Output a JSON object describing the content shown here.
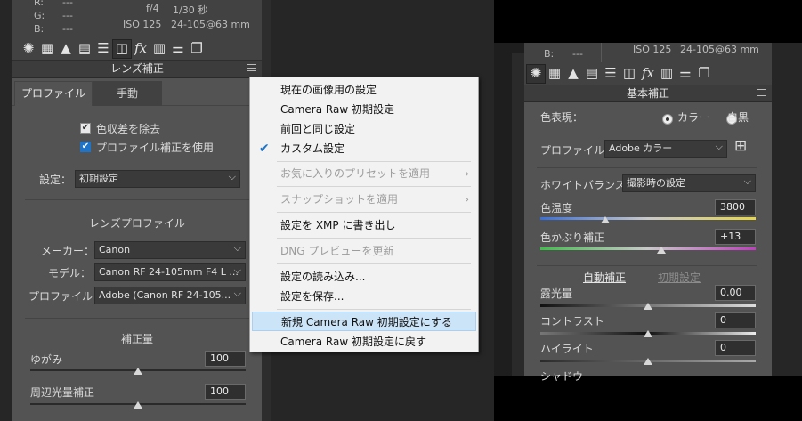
{
  "left": {
    "info": {
      "r_label": "R:",
      "r_val": "---",
      "g_label": "G:",
      "g_val": "---",
      "b_label": "B:",
      "b_val": "---",
      "aperture": "f/4",
      "shutter": "1/30 秒",
      "iso": "ISO 125",
      "lens": "24-105@63 mm"
    },
    "section_title": "レンズ補正",
    "tabs": {
      "profile": "プロファイル",
      "manual": "手動"
    },
    "checkboxes": {
      "remove_ca": "色収差を除去",
      "use_profile": "プロファイル補正を使用"
    },
    "setting_label": "設定：",
    "setting_value": "初期設定",
    "lens_profile_title": "レンズプロファイル",
    "maker_label": "メーカー：",
    "maker_value": "Canon",
    "model_label": "モデル：",
    "model_value": "Canon RF 24-105mm F4 L ...",
    "profile_label": "プロファイル：",
    "profile_value": "Adobe (Canon RF 24-105...",
    "amount_title": "補正量",
    "distortion_label": "ゆがみ",
    "distortion_value": "100",
    "distortion_level": 0.5,
    "vignette_label": "周辺光量補正",
    "vignette_value": "100",
    "vignette_level": 0.5
  },
  "menu": {
    "items": {
      "current": "現在の画像用の設定",
      "cr_default": "Camera Raw 初期設定",
      "previous": "前回と同じ設定",
      "custom": "カスタム設定",
      "favorite": "お気に入りのプリセットを適用",
      "snapshot": "スナップショットを適用",
      "export_xmp": "設定を XMP に書き出し",
      "dng_preview": "DNG プレビューを更新",
      "load": "設定の読み込み...",
      "save": "設定を保存...",
      "new_default": "新規 Camera Raw 初期設定にする",
      "reset_default": "Camera Raw 初期設定に戻す"
    }
  },
  "right": {
    "info": {
      "b_label": "B:",
      "b_val": "---",
      "iso": "ISO 125",
      "lens": "24-105@63 mm"
    },
    "section_title": "基本補正",
    "treatment_label": "色表現：",
    "color_option": "カラー",
    "bw_option": "白黒",
    "profile_label": "プロファイル：",
    "profile_value": "Adobe カラー",
    "wb_label": "ホワイトバランス：",
    "wb_value": "撮影時の設定",
    "temp_label": "色温度",
    "temp_value": "3800",
    "temp_level": 0.3,
    "tint_label": "色かぶり補正",
    "tint_value": "+13",
    "tint_level": 0.56,
    "auto": "自動補正",
    "default": "初期設定",
    "exposure_label": "露光量",
    "exposure_value": "0.00",
    "exposure_level": 0.5,
    "contrast_label": "コントラスト",
    "contrast_value": "0",
    "contrast_level": 0.5,
    "highlights_label": "ハイライト",
    "highlights_value": "0",
    "highlights_level": 0.5,
    "shadows_label": "シャドウ"
  }
}
